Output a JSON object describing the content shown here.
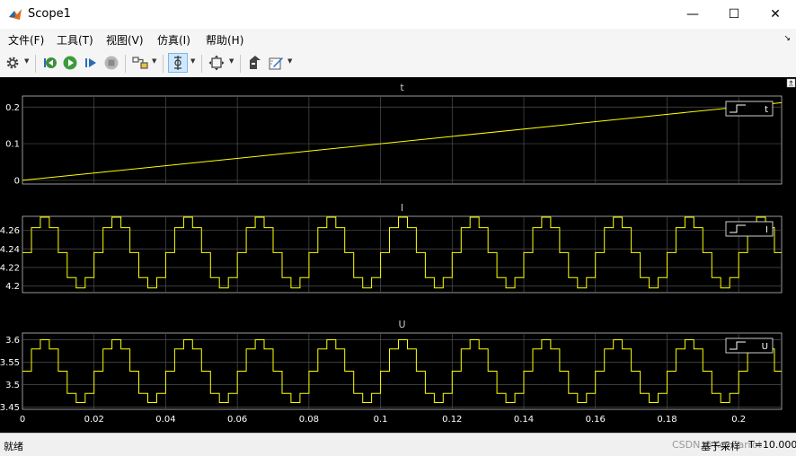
{
  "window": {
    "title": "Scope1",
    "minimize": "—",
    "maximize": "☐",
    "close": "✕"
  },
  "menu": {
    "items": [
      "文件(F)",
      "工具(T)",
      "视图(V)",
      "仿真(I)",
      "帮助(H)"
    ],
    "corner": "↘"
  },
  "toolbar": {
    "icons": [
      "gear-icon",
      "step-back-icon",
      "run-icon",
      "step-forward-icon",
      "stop-icon",
      "highlight-block-icon",
      "zoom-icon",
      "autoscale-icon",
      "restore-icon",
      "style-icon"
    ]
  },
  "colors": {
    "trace": "#ffff00",
    "axes_bg": "#000000",
    "grid": "#505050",
    "text": "#ffffff"
  },
  "chart_data": [
    {
      "type": "line",
      "title": "t",
      "x": [
        0,
        0.212
      ],
      "y": [
        0,
        0.212
      ],
      "ylim": [
        -0.01,
        0.23
      ],
      "yticks": [
        "0",
        "0.1",
        "0.2"
      ],
      "legend": {
        "label": "t",
        "placement": "top-right"
      },
      "grid": true
    },
    {
      "type": "line",
      "title": "I",
      "signal": {
        "offset": 4.236,
        "amplitude": 0.038,
        "period": 0.02,
        "phase": 0.0,
        "step": 0.0025
      },
      "xlim": [
        0,
        0.212
      ],
      "ylim": [
        4.193,
        4.275
      ],
      "yticks": [
        "4.2",
        "4.22",
        "4.24",
        "4.26"
      ],
      "legend": {
        "label": "I",
        "placement": "top-right"
      },
      "grid": true
    },
    {
      "type": "line",
      "title": "U",
      "signal": {
        "offset": 3.53,
        "amplitude": 0.07,
        "period": 0.02,
        "phase": 0.0,
        "step": 0.0025
      },
      "xlim": [
        0,
        0.212
      ],
      "ylim": [
        3.445,
        3.615
      ],
      "yticks": [
        "3.45",
        "3.5",
        "3.55",
        "3.6"
      ],
      "legend": {
        "label": "U",
        "placement": "top-right"
      },
      "grid": true,
      "xticks": [
        "0",
        "0.02",
        "0.04",
        "0.06",
        "0.08",
        "0.1",
        "0.12",
        "0.14",
        "0.16",
        "0.18",
        "0.2"
      ]
    }
  ],
  "status": {
    "left": "就绪",
    "mid": "基于采样",
    "right": "T=10.000",
    "watermark": "CSDN @KeyCarrot"
  }
}
